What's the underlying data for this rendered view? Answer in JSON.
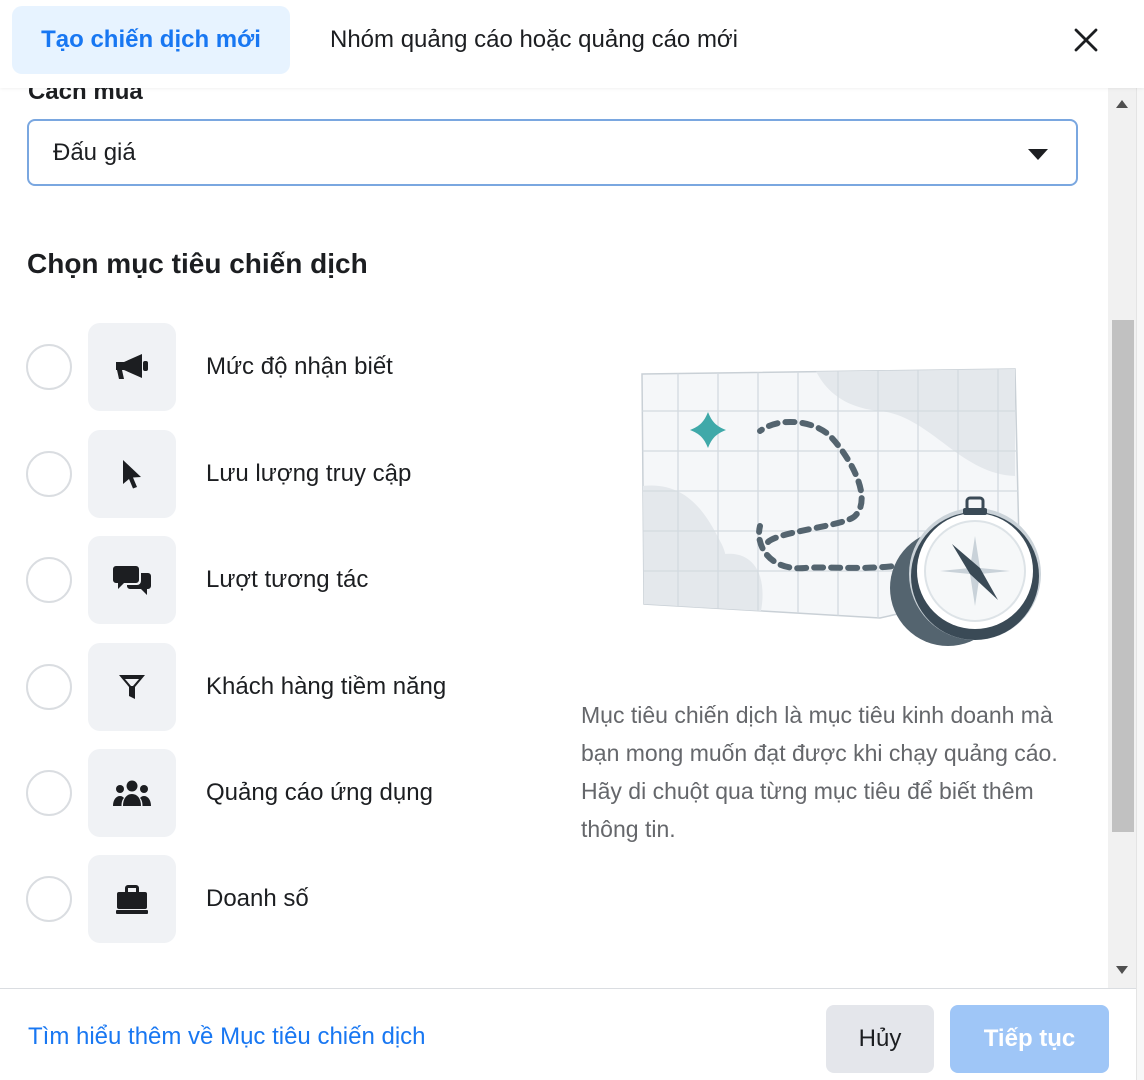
{
  "colors": {
    "accent": "#1877f2",
    "active_tab_bg": "#e7f3ff",
    "disabled_primary": "#9fc6f7",
    "icon_bg": "#f0f2f5"
  },
  "header": {
    "tabs": [
      {
        "label": "Tạo chiến dịch mới",
        "active": true
      },
      {
        "label": "Nhóm quảng cáo hoặc quảng cáo mới",
        "active": false
      }
    ],
    "close_icon": "close-icon"
  },
  "buying_type": {
    "label": "Cách mua",
    "value": "Đấu giá"
  },
  "objectives": {
    "title": "Chọn mục tiêu chiến dịch",
    "items": [
      {
        "label": "Mức độ nhận biết",
        "icon": "megaphone-icon"
      },
      {
        "label": "Lưu lượng truy cập",
        "icon": "cursor-icon"
      },
      {
        "label": "Lượt tương tác",
        "icon": "chat-bubbles-icon"
      },
      {
        "label": "Khách hàng tiềm năng",
        "icon": "funnel-icon"
      },
      {
        "label": "Quảng cáo ứng dụng",
        "icon": "people-icon"
      },
      {
        "label": "Doanh số",
        "icon": "briefcase-icon"
      }
    ]
  },
  "illustration": {
    "icon": "map-compass-illustration"
  },
  "description": "Mục tiêu chiến dịch là mục tiêu kinh doanh mà bạn mong muốn đạt được khi chạy quảng cáo. Hãy di chuột qua từng mục tiêu để biết thêm thông tin.",
  "footer": {
    "learn_more": "Tìm hiểu thêm về Mục tiêu chiến dịch",
    "cancel": "Hủy",
    "continue": "Tiếp tục"
  }
}
